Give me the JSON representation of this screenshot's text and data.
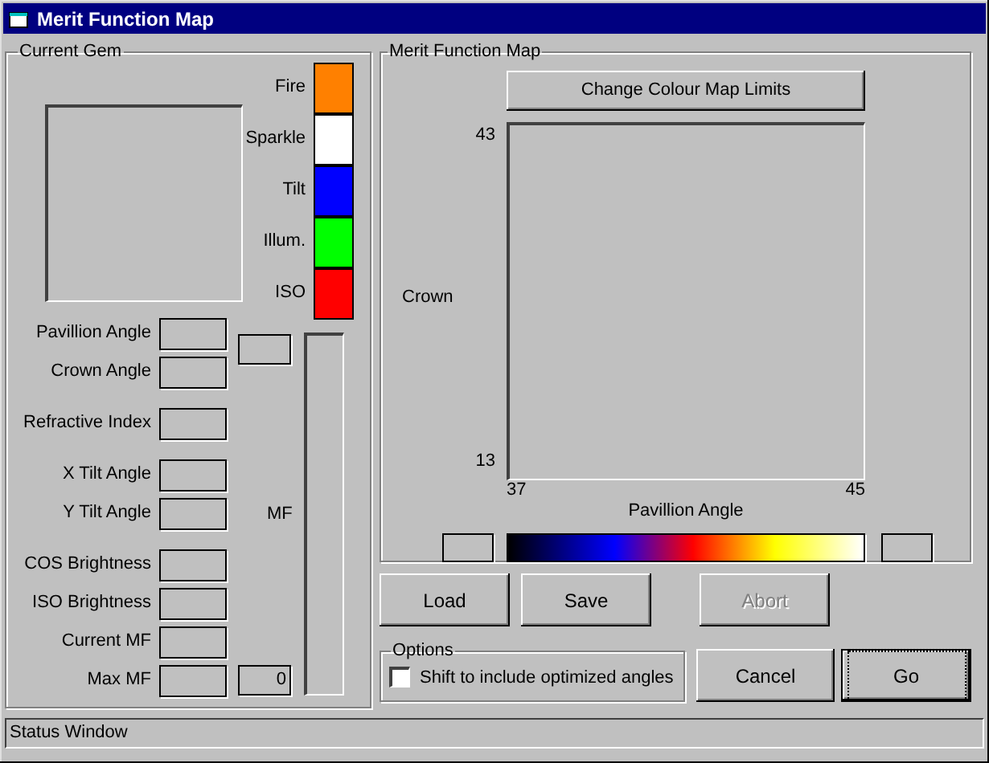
{
  "window": {
    "title": "Merit Function Map"
  },
  "current_gem": {
    "title": "Current Gem",
    "legend": [
      {
        "label": "Fire",
        "color": "#ff8000"
      },
      {
        "label": "Sparkle",
        "color": "#ffffff"
      },
      {
        "label": "Tilt",
        "color": "#0000ff"
      },
      {
        "label": "Illum.",
        "color": "#00ff00"
      },
      {
        "label": "ISO",
        "color": "#ff0000"
      }
    ],
    "field_groups": [
      [
        {
          "label": "Pavillion Angle"
        },
        {
          "label": "Crown Angle"
        }
      ],
      [
        {
          "label": "Refractive Index"
        }
      ],
      [
        {
          "label": "X Tilt Angle"
        },
        {
          "label": "Y Tilt Angle"
        }
      ],
      [
        {
          "label": "COS Brightness"
        },
        {
          "label": "ISO Brightness"
        },
        {
          "label": "Current MF"
        },
        {
          "label": "Max MF"
        }
      ]
    ],
    "mf_label": "MF",
    "mf_min": "0"
  },
  "merit_map": {
    "title": "Merit Function Map",
    "limits_button": "Change Colour Map Limits",
    "y_label": "Crown",
    "y_max": "43",
    "y_min": "13",
    "x_label": "Pavillion Angle",
    "x_min": "37",
    "x_max": "45"
  },
  "buttons": [
    {
      "label": "Load",
      "disabled": false
    },
    {
      "label": "Save",
      "disabled": false
    },
    {
      "label": "Abort",
      "disabled": true
    }
  ],
  "options": {
    "title": "Options",
    "checkbox": {
      "label": "Shift to include optimized angles",
      "checked": false
    }
  },
  "action_buttons": [
    {
      "label": "Cancel",
      "default": false
    },
    {
      "label": "Go",
      "default": true
    }
  ],
  "status_bar": "Status Window"
}
